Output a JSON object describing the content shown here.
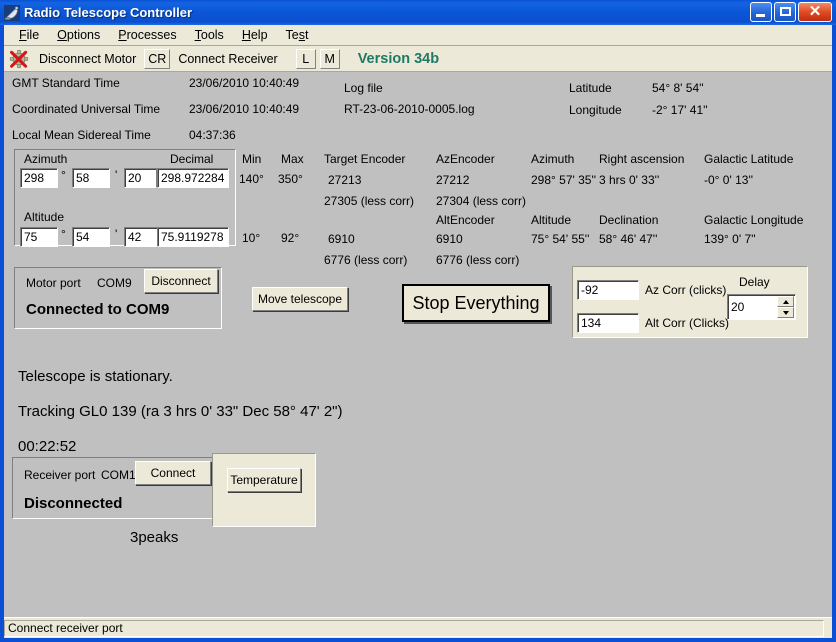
{
  "window": {
    "title": "Radio Telescope Controller",
    "icon": "satellite-dish-icon",
    "minimize": "minimize-icon",
    "maximize": "maximize-icon",
    "close": "close-icon"
  },
  "menu": {
    "items": [
      {
        "label": "File",
        "accel": "F"
      },
      {
        "label": "Options",
        "accel": "O"
      },
      {
        "label": "Processes",
        "accel": "P"
      },
      {
        "label": "Tools",
        "accel": "T"
      },
      {
        "label": "Help",
        "accel": "H"
      },
      {
        "label": "Test",
        "accel": "s"
      }
    ]
  },
  "toolbar": {
    "motor_icon": "gear-disconnect-icon",
    "disconnect_motor": "Disconnect Motor",
    "cr_button": "CR",
    "connect_receiver": "Connect Receiver",
    "l_button": "L",
    "m_button": "M",
    "version": "Version 34b",
    "version_color": "#1f7a64"
  },
  "times": {
    "gmt_label": "GMT Standard Time",
    "gmt_value": "23/06/2010 10:40:49",
    "utc_label": "Coordinated Universal Time",
    "utc_value": "23/06/2010 10:40:49",
    "lmst_label": "Local Mean Sidereal Time",
    "lmst_value": "04:37:36"
  },
  "logfile": {
    "label": "Log file",
    "name": "RT-23-06-2010-0005.log"
  },
  "site": {
    "latitude_label": "Latitude",
    "latitude_value": "54° 8' 54''",
    "longitude_label": "Longitude",
    "longitude_value": "-2° 17' 41''"
  },
  "coords": {
    "azimuth_label": "Azimuth",
    "azimuth_deg": "298",
    "azimuth_min": "58",
    "azimuth_sec": "20",
    "azimuth_decimal": "298.972284",
    "altitude_label": "Altitude",
    "altitude_deg": "75",
    "altitude_min": "54",
    "altitude_sec": "42",
    "altitude_decimal": "75.9119278",
    "decimal_label": "Decimal",
    "deg_symbol": "°",
    "min_symbol": "'",
    "sec_symbol": "''",
    "min_label": "Min",
    "max_label": "Max",
    "az_min": "140°",
    "az_max": "350°",
    "alt_min": "10°",
    "alt_max": "92°"
  },
  "encoders": {
    "target_label": "Target Encoder",
    "target_az": "27213",
    "target_az_less": "27305 (less corr)",
    "target_alt": "6910",
    "target_alt_less": "6776 (less corr)",
    "az_encoder_label": "AzEncoder",
    "az_encoder": "27212",
    "az_encoder_less": "27304 (less corr)",
    "alt_encoder_label": "AltEncoder",
    "alt_encoder": "6910",
    "alt_encoder_less": "6776 (less corr)",
    "azimuth_label": "Azimuth",
    "azimuth_value": "298° 57' 35''",
    "altitude_label": "Altitude",
    "altitude_value": "75° 54' 55''"
  },
  "celestial": {
    "ra_label": "Right ascension",
    "ra_value": "3 hrs 0' 33''",
    "dec_label": "Declination",
    "dec_value": "58° 46' 47''",
    "glat_label": "Galactic Latitude",
    "glat_value": "-0° 0' 13''",
    "glon_label": "Galactic Longitude",
    "glon_value": "139° 0' 7''"
  },
  "motor": {
    "port_label": "Motor port",
    "port_value": "COM9",
    "disconnect_button": "Disconnect",
    "status": "Connected to COM9"
  },
  "actions": {
    "move_telescope": "Move telescope",
    "stop_everything": "Stop Everything"
  },
  "corrections": {
    "az_corr_value": "-92",
    "az_corr_label": "Az Corr (clicks)",
    "alt_corr_value": "134",
    "alt_corr_label": "Alt Corr (Clicks)",
    "delay_label": "Delay",
    "delay_value": "20",
    "spinner_up": "spinner-up-icon",
    "spinner_down": "spinner-down-icon"
  },
  "status": {
    "line1": "Telescope is stationary.",
    "line2": "Tracking GL0 139 (ra 3 hrs 0' 33\"  Dec 58° 47' 2\")",
    "line3": "00:22:52"
  },
  "receiver": {
    "port_label": "Receiver port",
    "port_value": "COM1",
    "connect_button": "Connect",
    "status": "Disconnected",
    "temperature_button": "Temperature",
    "mode_label": "3peaks"
  },
  "statusbar": {
    "text": "Connect receiver port"
  }
}
